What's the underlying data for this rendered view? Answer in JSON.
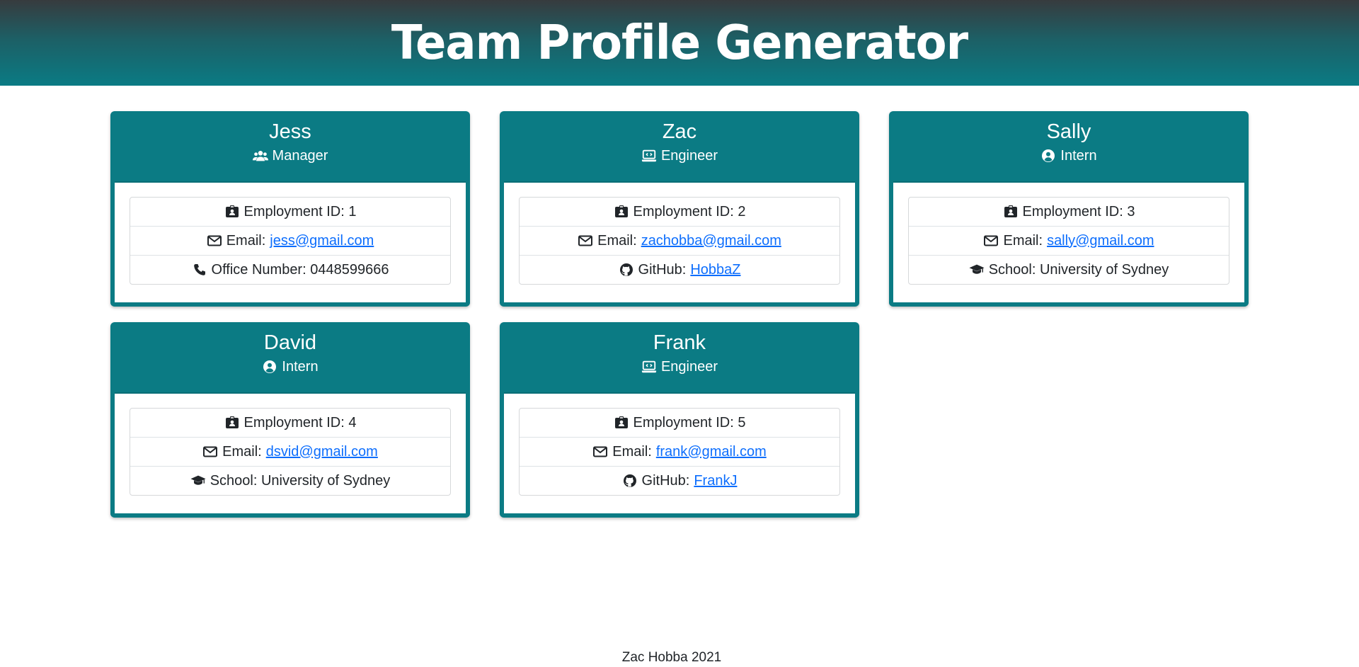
{
  "header": {
    "title": "Team Profile Generator"
  },
  "colors": {
    "accent": "#0b7b84",
    "link": "#0d6efd"
  },
  "cards": [
    {
      "name": "Jess",
      "role": "Manager",
      "role_icon": "users-icon",
      "id_label": "Employment ID: 1",
      "email_label": "Email:",
      "email": "jess@gmail.com",
      "extra_label": "Office Number: 0448599666",
      "extra_icon": "phone-icon"
    },
    {
      "name": "Zac",
      "role": "Engineer",
      "role_icon": "laptop-code-icon",
      "id_label": "Employment ID: 2",
      "email_label": "Email:",
      "email": "zachobba@gmail.com",
      "extra_label": "GitHub:",
      "extra_link": "HobbaZ",
      "extra_icon": "github-icon"
    },
    {
      "name": "Sally",
      "role": "Intern",
      "role_icon": "user-circle-icon",
      "id_label": "Employment ID: 3",
      "email_label": "Email:",
      "email": "sally@gmail.com",
      "extra_label": "School: University of Sydney",
      "extra_icon": "graduation-cap-icon"
    },
    {
      "name": "David",
      "role": "Intern",
      "role_icon": "user-circle-icon",
      "id_label": "Employment ID: 4",
      "email_label": "Email:",
      "email": "dsvid@gmail.com",
      "extra_label": "School: University of Sydney",
      "extra_icon": "graduation-cap-icon"
    },
    {
      "name": "Frank",
      "role": "Engineer",
      "role_icon": "laptop-code-icon",
      "id_label": "Employment ID: 5",
      "email_label": "Email:",
      "email": "frank@gmail.com",
      "extra_label": "GitHub:",
      "extra_link": "FrankJ",
      "extra_icon": "github-icon"
    }
  ],
  "footer": {
    "text": "Zac Hobba 2021"
  }
}
